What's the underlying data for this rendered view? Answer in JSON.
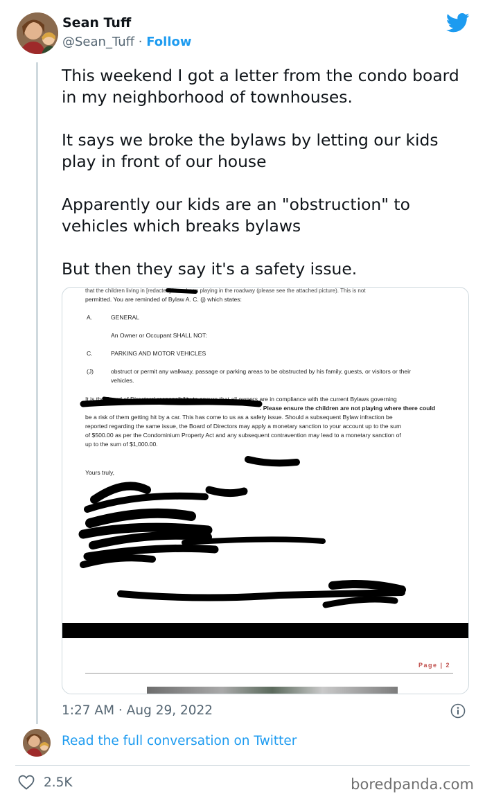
{
  "author": {
    "name": "Sean Tuff",
    "handle": "@Sean_Tuff",
    "separator": "·",
    "follow_label": "Follow"
  },
  "tweet": {
    "text": "This weekend I got a letter from the condo board in my neighborhood of townhouses.\n\nIt says we broke the bylaws by letting our kids play in front of our house\n\nApparently our kids are an \"obstruction\" to vehicles which breaks bylaws\n\nBut then they say it's a safety issue.",
    "timestamp": "1:27 AM · Aug 29, 2022"
  },
  "letter": {
    "intro_line1": "that the children living in [redacted] have been playing in the roadway (please see the attached picture). This is not",
    "intro_line2": "permitted. You are reminded of Bylaw A. C. (j) which states:",
    "item_a_marker": "A.",
    "item_a_title": "GENERAL",
    "item_a_sub": "An Owner or Occupant SHALL NOT:",
    "item_c_marker": "C.",
    "item_c_title": "PARKING AND MOTOR VEHICLES",
    "item_j_marker": "(J)",
    "item_j_line1": "obstruct or permit any walkway, passage or parking areas to be obstructed by his family, guests, or visitors or their",
    "item_j_line2": "vehicles.",
    "para_line1": "It is the Board of Directors' responsibility to ensure that all owners are in compliance with the current Bylaws governing",
    "para_line2": ". Please ensure the children are not playing where there could",
    "para_line3": "be a risk of them getting hit by a car. This has come to us as a safety issue. Should a subsequent Bylaw infraction be",
    "para_line4": "reported regarding the same issue, the Board of Directors may apply a monetary sanction to your account up to the sum",
    "para_line5": "of $500.00 as per the Condominium Property Act and any subsequent contravention may lead to a monetary sanction of",
    "para_line6": "up to the sum of $1,000.00.",
    "closing": "Yours truly,",
    "page_label": "Page | 2"
  },
  "footer": {
    "read_more": "Read the full conversation on Twitter",
    "like_count": "2.5K",
    "watermark": "boredpanda.com"
  },
  "icons": {
    "brand": "twitter-bird-icon",
    "info": "info-icon",
    "like": "heart-icon"
  },
  "colors": {
    "accent": "#1d9bf0",
    "muted": "#536471",
    "text": "#0f1419",
    "border": "#cfd9de"
  }
}
